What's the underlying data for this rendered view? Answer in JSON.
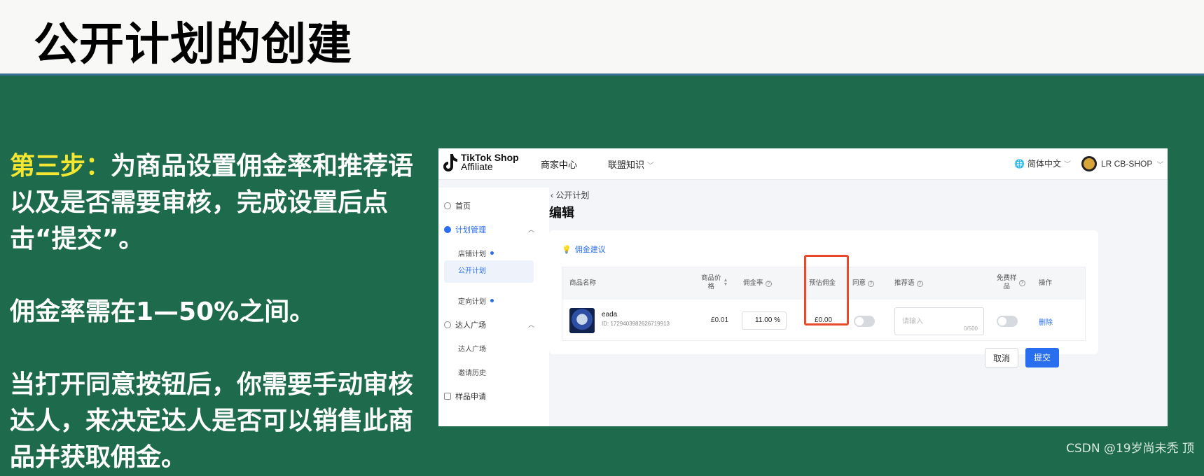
{
  "slide": {
    "title": "公开计划的创建",
    "step_label": "第三步：",
    "step_text": "为商品设置佣金率和推荐语以及是否需要审核，完成设置后点击“提交”。",
    "rate_note": "佣金率需在1—50%之间。",
    "review_note": "当打开同意按钮后，你需要手动审核达人，来决定达人是否可以销售此商品并获取佣金。",
    "watermark": "CSDN @19岁尚未秃 顶"
  },
  "app": {
    "logo": {
      "line1": "TikTok Shop",
      "line2": "Affiliate"
    },
    "nav": {
      "merchant_center": "商家中心",
      "alliance_knowledge": "联盟知识",
      "language": "简体中文",
      "shop_name": "LR CB-SHOP"
    },
    "sidebar": {
      "home": "首页",
      "plan_management": "计划管理",
      "store_plan": "店铺计划",
      "public_plan": "公开计划",
      "targeted_plan": "定向计划",
      "creator_plaza_group": "达人广场",
      "creator_plaza": "达人广场",
      "invite_history": "邀请历史",
      "sample_request": "样品申请"
    },
    "breadcrumb": "‹ 公开计划",
    "page_title": "编辑",
    "section_label": "佣金建议",
    "table": {
      "headers": {
        "product_name": "商品名称",
        "price_line1": "商品价",
        "price_line2": "格",
        "commission_rate": "佣金率",
        "est_commission": "预估佣金",
        "approve": "同意",
        "pitch": "推荐语",
        "free_sample_line1": "免费样",
        "free_sample_line2": "品",
        "actions": "操作"
      },
      "row": {
        "name": "eada",
        "id": "ID: 1729403982626719913",
        "price": "£0.01",
        "rate": "11.00 %",
        "est": "£0.00",
        "pitch_placeholder": "请输入",
        "pitch_count": "0/500",
        "delete": "删除"
      }
    },
    "buttons": {
      "cancel": "取消",
      "submit": "提交"
    }
  }
}
